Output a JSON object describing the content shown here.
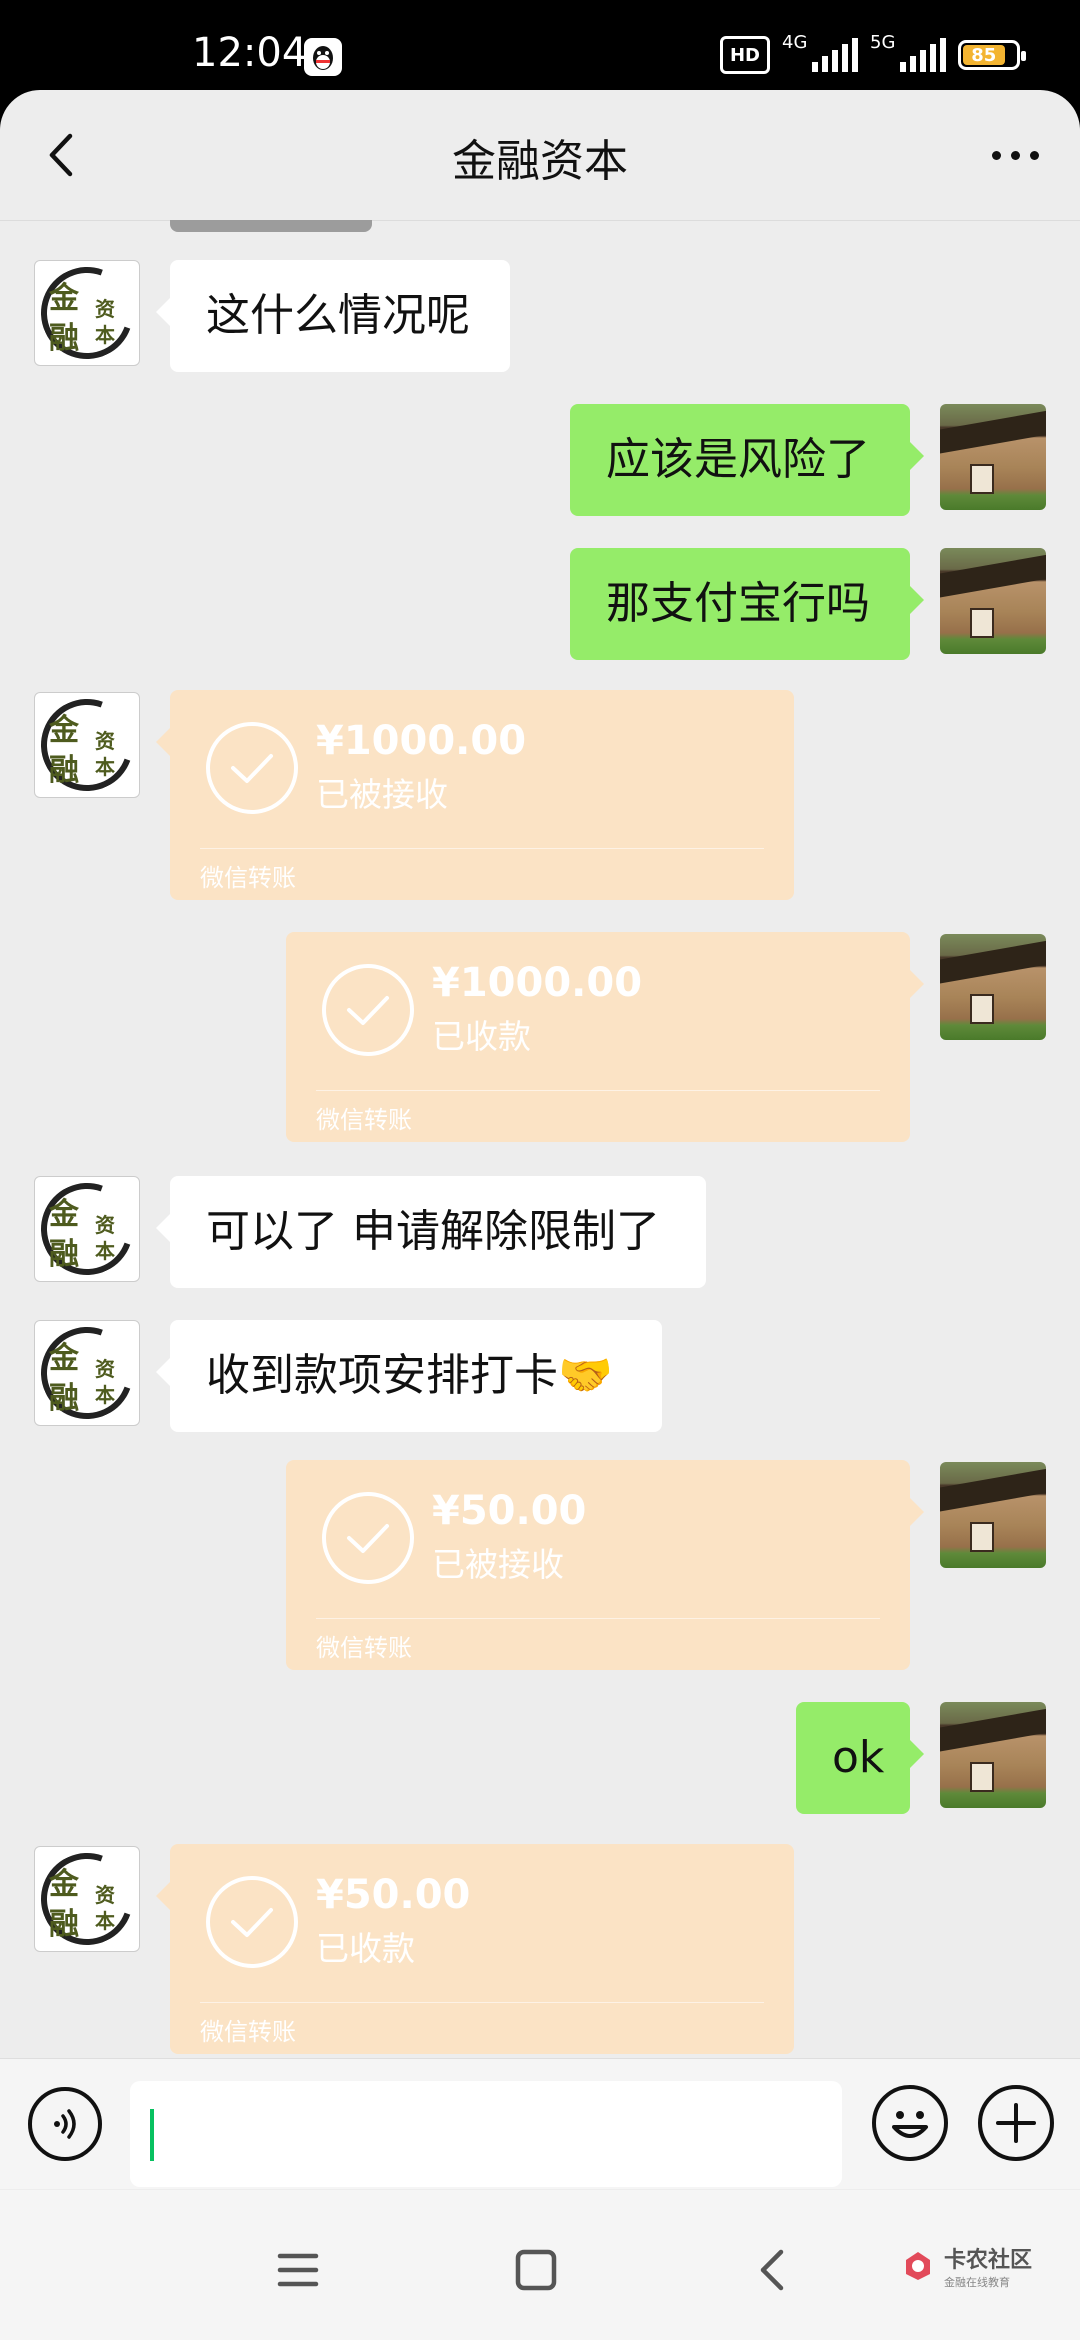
{
  "status_bar": {
    "time": "12:04",
    "network_badge": "HD",
    "signal_1_label": "4G",
    "signal_2_label": "5G",
    "battery_level": "85"
  },
  "header": {
    "title": "金融资本",
    "back_icon": "chevron-left-icon",
    "more_icon": "more-dots-icon"
  },
  "avatars": {
    "contact_logo_chars": [
      "金",
      "融",
      "资",
      "本"
    ]
  },
  "messages": [
    {
      "side": "in",
      "type": "text",
      "text": "这什么情况呢"
    },
    {
      "side": "out",
      "type": "text",
      "text": "应该是风险了"
    },
    {
      "side": "out",
      "type": "text",
      "text": "那支付宝行吗"
    },
    {
      "side": "in",
      "type": "transfer",
      "amount": "¥1000.00",
      "status": "已被接收",
      "footer": "微信转账"
    },
    {
      "side": "out",
      "type": "transfer",
      "amount": "¥1000.00",
      "status": "已收款",
      "footer": "微信转账"
    },
    {
      "side": "in",
      "type": "text",
      "text": "可以了 申请解除限制了"
    },
    {
      "side": "in",
      "type": "text",
      "text": "收到款项安排打卡🤝"
    },
    {
      "side": "out",
      "type": "transfer",
      "amount": "¥50.00",
      "status": "已被接收",
      "footer": "微信转账"
    },
    {
      "side": "out",
      "type": "text",
      "text": "ok"
    },
    {
      "side": "in",
      "type": "transfer",
      "amount": "¥50.00",
      "status": "已收款",
      "footer": "微信转账"
    }
  ],
  "input_bar": {
    "voice_icon": "voice-icon",
    "emoji_icon": "emoji-icon",
    "plus_icon": "plus-icon"
  },
  "system_nav": {
    "menu_icon": "menu-icon",
    "home_icon": "home-icon",
    "back_icon": "back-icon",
    "watermark_main": "卡农社区",
    "watermark_sub": "金融在线教育"
  }
}
